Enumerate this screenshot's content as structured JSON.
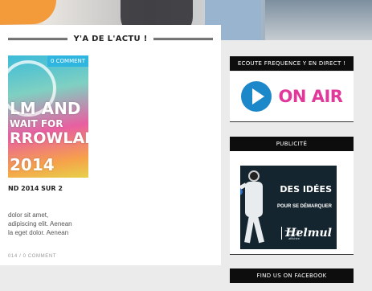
{
  "section": {
    "title": "Y'A DE L'ACTU !"
  },
  "post": {
    "comment_badge": "0 COMMENT",
    "thumbnail_text": [
      "LM AND",
      "WAIT FOR",
      "RROWLAN",
      "2014"
    ],
    "title": "ND 2014 SUR 2",
    "excerpt_lines": [
      "dolor sit amet,",
      "adipiscing elit. Aenean",
      "la eget dolor. Aenean"
    ],
    "meta": "014 / 0 COMMENT"
  },
  "sidebar": {
    "radio": {
      "title": "ECOUTE FREQUENCE Y EN DIRECT !",
      "on_air_label": "ON AIR"
    },
    "ad": {
      "title": "PUBLICITÉ",
      "headline_line1": "DES IDÉES",
      "subline": "POUR SE DÉMARQUER",
      "small_text": "agence de publicité affichée",
      "brand": "Helmul"
    },
    "facebook": {
      "title": "FIND US ON FACEBOOK"
    }
  },
  "colors": {
    "accent_blue": "#2fb6e0",
    "on_air_pink": "#e1389a",
    "play_blue": "#1d88c9",
    "widget_header": "#0d0d0d"
  }
}
